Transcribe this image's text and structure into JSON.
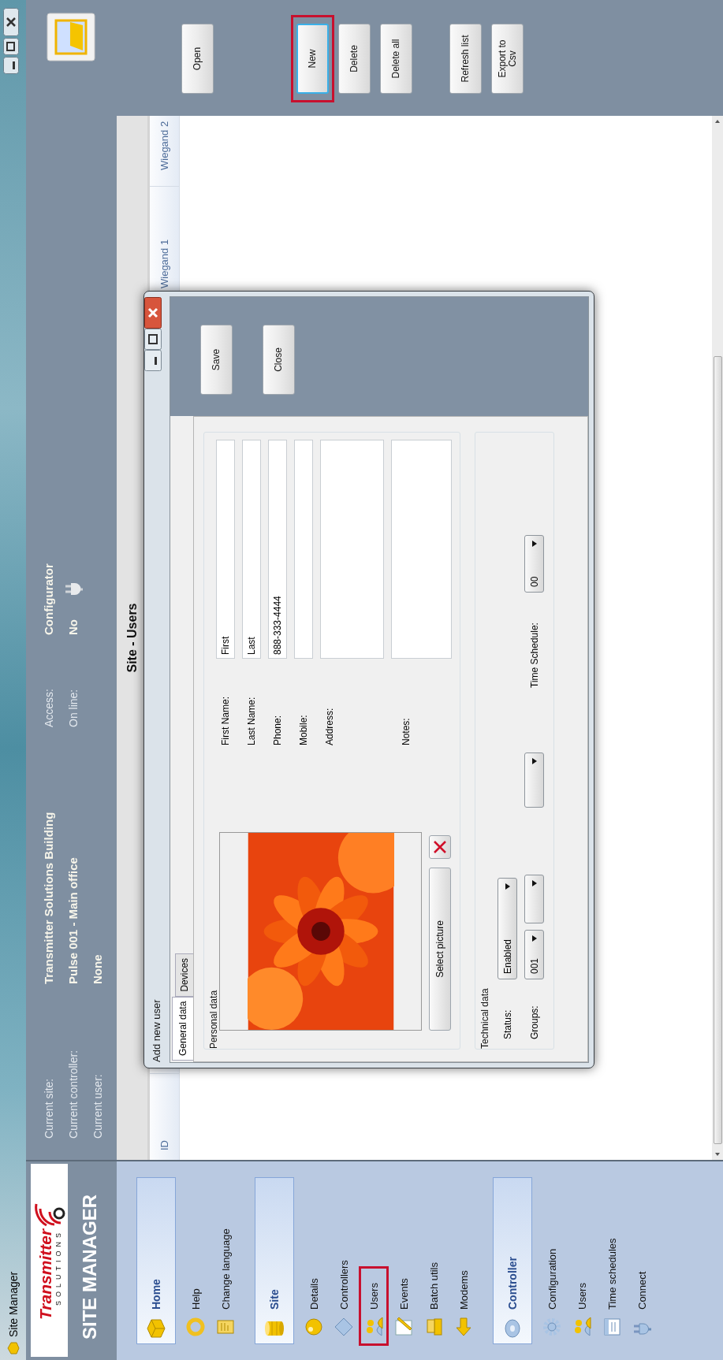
{
  "window": {
    "title": "Site Manager"
  },
  "brand": {
    "logo_name": "Transmitter",
    "logo_tagline": "SOLUTIONS",
    "app_name": "SITE MANAGER"
  },
  "header": {
    "context": [
      {
        "label": "Current site:",
        "value": "Transmitter Solutions Building"
      },
      {
        "label": "Current controller:",
        "value": "Pulse 001 - Main office"
      },
      {
        "label": "Current user:",
        "value": "None"
      }
    ],
    "status": [
      {
        "label": "Access:",
        "value": "Configurator"
      },
      {
        "label": "On line:",
        "value": "No",
        "online": false
      }
    ]
  },
  "sidebar": {
    "groups": [
      {
        "title": "Home",
        "items": [
          {
            "label": "Help",
            "highlighted": false
          },
          {
            "label": "Change language",
            "highlighted": false
          }
        ]
      },
      {
        "title": "Site",
        "items": [
          {
            "label": "Details",
            "highlighted": false
          },
          {
            "label": "Controllers",
            "highlighted": false
          },
          {
            "label": "Users",
            "highlighted": true
          },
          {
            "label": "Events",
            "highlighted": false
          },
          {
            "label": "Batch utils",
            "highlighted": false
          },
          {
            "label": "Modems",
            "highlighted": false
          }
        ]
      },
      {
        "title": "Controller",
        "items": [
          {
            "label": "Configuration",
            "highlighted": false
          },
          {
            "label": "Users",
            "highlighted": false
          },
          {
            "label": "Time schedules",
            "highlighted": false
          },
          {
            "label": "Connect",
            "highlighted": false
          }
        ]
      }
    ]
  },
  "page_title": "Site - Users",
  "table": {
    "columns": [
      "ID",
      "Wiegand 1",
      "Wiegand 2"
    ]
  },
  "toolbar": {
    "groups": [
      [
        {
          "label": "Open",
          "focused": false,
          "highlighted": false
        }
      ],
      [
        {
          "label": "New",
          "focused": true,
          "highlighted": true
        },
        {
          "label": "Delete",
          "focused": false,
          "highlighted": false
        },
        {
          "label": "Delete all",
          "focused": false,
          "highlighted": false
        }
      ],
      [
        {
          "label": "Refresh list",
          "focused": false,
          "highlighted": false
        },
        {
          "label": "Export to Csv",
          "focused": false,
          "highlighted": false
        }
      ]
    ]
  },
  "dialog": {
    "title": "Add new user",
    "tabs": [
      {
        "label": "General data",
        "selected": true
      },
      {
        "label": "Devices",
        "selected": false
      }
    ],
    "personal": {
      "title": "Personal data",
      "select_button": "Select picture",
      "fields": [
        {
          "label": "First Name:",
          "kind": "text",
          "value": "First"
        },
        {
          "label": "Last Name:",
          "kind": "text",
          "value": "Last"
        },
        {
          "label": "Phone:",
          "kind": "text",
          "value": "888-333-4444"
        },
        {
          "label": "Mobile:",
          "kind": "text"
        },
        {
          "label": "Address:",
          "kind": "multiline"
        },
        {
          "label": "Notes:",
          "kind": "multiline"
        }
      ]
    },
    "technical": {
      "title": "Technical data",
      "status": {
        "label": "Status:",
        "value": "Enabled"
      },
      "groups": {
        "label": "Groups:",
        "dropdowns": [
          {
            "kind": "dropdown",
            "value": "001"
          },
          {
            "kind": "dropdown"
          },
          {
            "kind": "dropdown"
          }
        ]
      },
      "time_schedule": {
        "label": "Time Schedule:",
        "value": "00"
      }
    },
    "buttons": [
      "Save",
      "Close"
    ]
  }
}
